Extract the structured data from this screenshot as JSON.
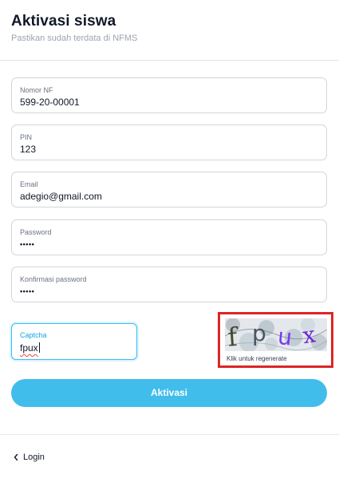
{
  "header": {
    "title": "Aktivasi siswa",
    "subtitle": "Pastikan sudah terdata di NFMS"
  },
  "form": {
    "nomor_nf": {
      "label": "Nomor NF",
      "value": "599-20-00001"
    },
    "pin": {
      "label": "PIN",
      "value": "123"
    },
    "email": {
      "label": "Email",
      "value": "adegio@gmail.com"
    },
    "password": {
      "label": "Password",
      "value": "•••••"
    },
    "konfirmasi_password": {
      "label": "Konfirmasi password",
      "value": "•••••"
    },
    "captcha": {
      "label": "Captcha",
      "value": "fpux",
      "image_text": "fpux",
      "caption": "Klik untuk regenerate"
    },
    "submit_label": "Aktivasi"
  },
  "footer": {
    "login_label": "Login"
  },
  "colors": {
    "accent": "#41bdec",
    "focus_border": "#38bdf8",
    "highlight_box": "#dc2626"
  },
  "icons": {
    "back": "chevron-left-icon"
  }
}
